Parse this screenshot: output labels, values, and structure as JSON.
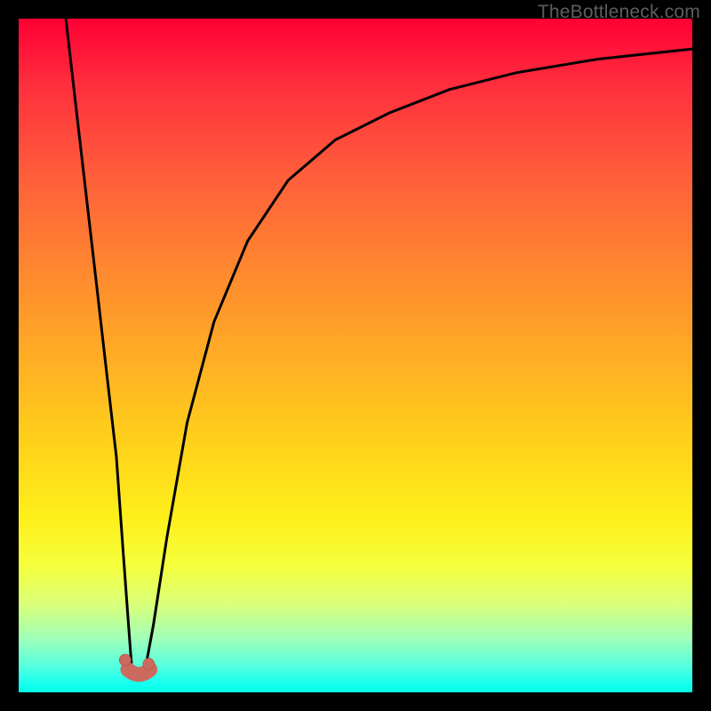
{
  "watermark": "TheBottleneck.com",
  "colors": {
    "frame_bg": "#000000",
    "curve_stroke": "#000000",
    "marker_fill": "#cc6a5f",
    "marker_stroke": "#b85a50"
  },
  "chart_data": {
    "type": "line",
    "title": "",
    "xlabel": "",
    "ylabel": "",
    "xlim": [
      0,
      100
    ],
    "ylim": [
      0,
      100
    ],
    "series": [
      {
        "name": "left-branch",
        "x": [
          7.0,
          8.5,
          10.0,
          11.5,
          13.0,
          14.5,
          15.5,
          16.3,
          16.8
        ],
        "y": [
          100,
          87,
          74,
          61,
          48,
          35,
          21,
          10,
          3.5
        ]
      },
      {
        "name": "right-branch",
        "x": [
          18.8,
          20.0,
          22.0,
          25.0,
          29.0,
          34.0,
          40.0,
          47.0,
          55.0,
          64.0,
          74.0,
          86.0,
          100.0
        ],
        "y": [
          3.5,
          10,
          23,
          40,
          55,
          67,
          76,
          82,
          86,
          89.5,
          92,
          94,
          95.5
        ]
      }
    ],
    "markers": [
      {
        "name": "dot-left",
        "x": 15.8,
        "y": 4.8,
        "r": 0.85
      },
      {
        "name": "dot-right",
        "x": 19.3,
        "y": 4.2,
        "r": 0.85
      }
    ],
    "trough": {
      "x0": 16.2,
      "y0": 2.6,
      "x1": 19.5,
      "y1": 2.6,
      "thickness": 2.2
    }
  }
}
